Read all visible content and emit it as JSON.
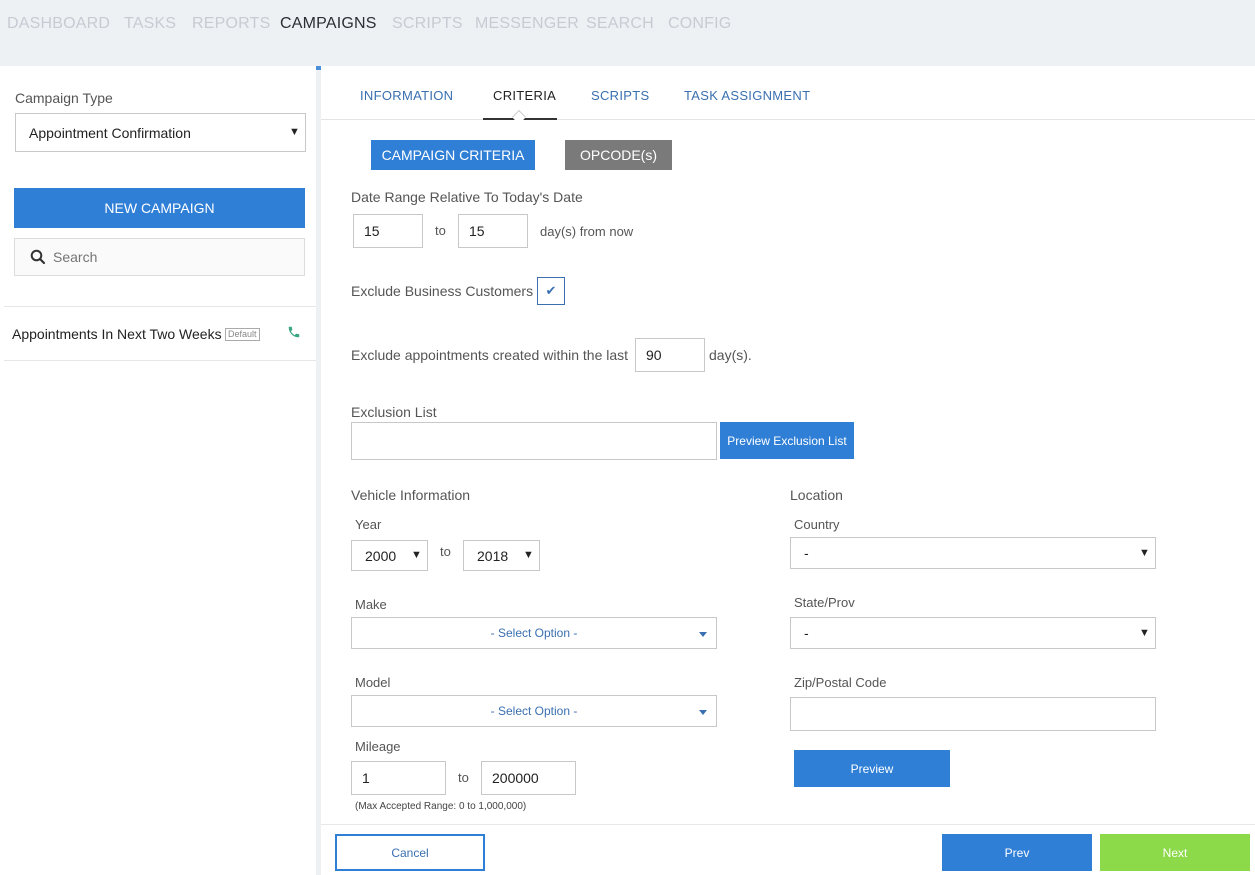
{
  "topnav": {
    "items": [
      "DASHBOARD",
      "TASKS",
      "REPORTS",
      "CAMPAIGNS",
      "SCRIPTS",
      "MESSENGER",
      "SEARCH",
      "CONFIG"
    ],
    "active": "CAMPAIGNS"
  },
  "sidebar": {
    "campaign_type_label": "Campaign Type",
    "campaign_type_value": "Appointment Confirmation",
    "new_campaign_label": "NEW CAMPAIGN",
    "search_placeholder": "Search",
    "campaigns": [
      {
        "name": "Appointments In Next Two Weeks",
        "badge": "Default",
        "icon": "phone-icon"
      }
    ]
  },
  "tabs": {
    "items": [
      "INFORMATION",
      "CRITERIA",
      "SCRIPTS",
      "TASK ASSIGNMENT"
    ],
    "active": "CRITERIA"
  },
  "subtabs": {
    "campaign_criteria": "CAMPAIGN CRITERIA",
    "opcodes": "OPCODE(s)"
  },
  "criteria": {
    "date_range_label": "Date Range Relative To Today's Date",
    "date_from": "15",
    "date_to_word": "to",
    "date_to": "15",
    "date_suffix": "day(s) from now",
    "exclude_business_label": "Exclude Business Customers",
    "exclude_business_checked": true,
    "exclude_created_label": "Exclude appointments created within the last",
    "exclude_created_value": "90",
    "exclude_created_suffix": "day(s).",
    "exclusion_list_label": "Exclusion List",
    "exclusion_list_value": "",
    "preview_exclusion_label": "Preview Exclusion List"
  },
  "vehicle": {
    "section_label": "Vehicle Information",
    "year_label": "Year",
    "year_from": "2000",
    "year_to_word": "to",
    "year_to": "2018",
    "make_label": "Make",
    "make_value": "- Select Option -",
    "model_label": "Model",
    "model_value": "- Select Option -",
    "mileage_label": "Mileage",
    "mileage_from": "1",
    "mileage_to_word": "to",
    "mileage_to": "200000",
    "mileage_note": "(Max Accepted Range: 0 to 1,000,000)"
  },
  "location": {
    "section_label": "Location",
    "country_label": "Country",
    "country_value": "-",
    "state_label": "State/Prov",
    "state_value": "-",
    "zip_label": "Zip/Postal Code",
    "zip_value": "",
    "preview_label": "Preview"
  },
  "footer": {
    "cancel_label": "Cancel",
    "prev_label": "Prev",
    "next_label": "Next"
  },
  "colors": {
    "accent_blue": "#2f7fd6",
    "next_green": "#8cd94a",
    "opcode_gray": "#7a7a7a",
    "phone_green": "#3aa682"
  }
}
